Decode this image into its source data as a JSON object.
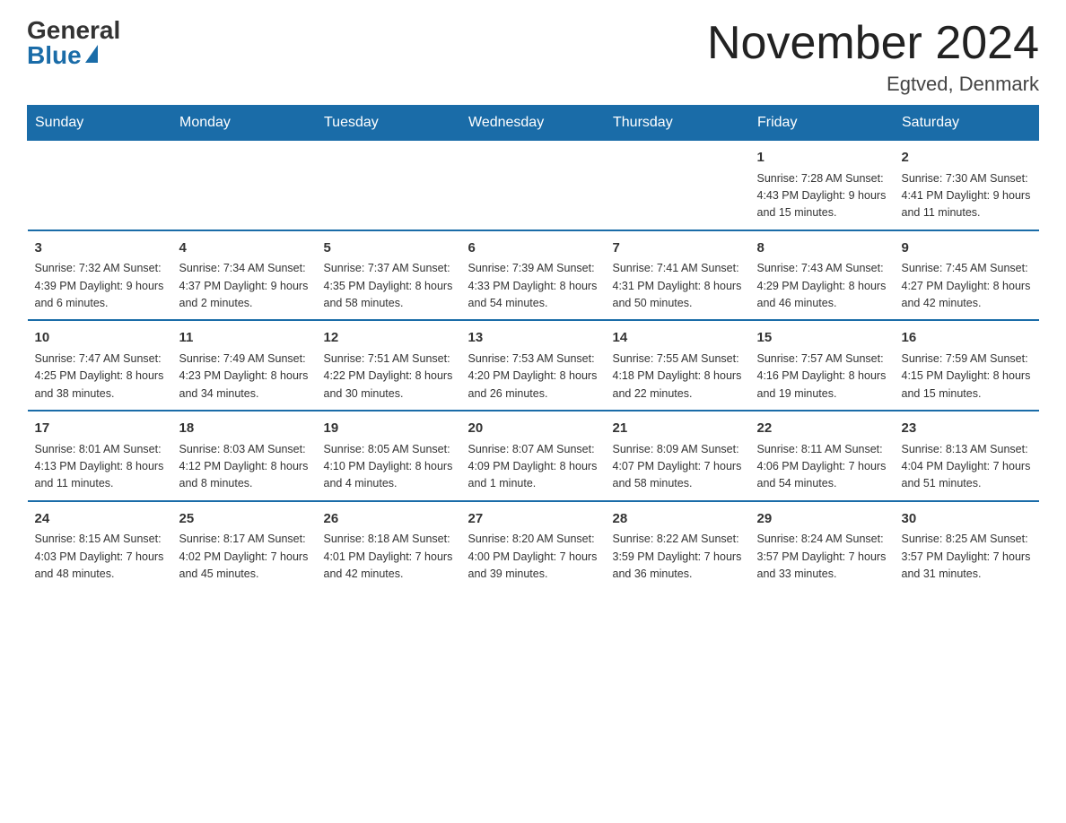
{
  "header": {
    "logo_general": "General",
    "logo_blue": "Blue",
    "month_title": "November 2024",
    "location": "Egtved, Denmark"
  },
  "days_of_week": [
    "Sunday",
    "Monday",
    "Tuesday",
    "Wednesday",
    "Thursday",
    "Friday",
    "Saturday"
  ],
  "weeks": [
    [
      {
        "day": "",
        "info": ""
      },
      {
        "day": "",
        "info": ""
      },
      {
        "day": "",
        "info": ""
      },
      {
        "day": "",
        "info": ""
      },
      {
        "day": "",
        "info": ""
      },
      {
        "day": "1",
        "info": "Sunrise: 7:28 AM\nSunset: 4:43 PM\nDaylight: 9 hours and 15 minutes."
      },
      {
        "day": "2",
        "info": "Sunrise: 7:30 AM\nSunset: 4:41 PM\nDaylight: 9 hours and 11 minutes."
      }
    ],
    [
      {
        "day": "3",
        "info": "Sunrise: 7:32 AM\nSunset: 4:39 PM\nDaylight: 9 hours and 6 minutes."
      },
      {
        "day": "4",
        "info": "Sunrise: 7:34 AM\nSunset: 4:37 PM\nDaylight: 9 hours and 2 minutes."
      },
      {
        "day": "5",
        "info": "Sunrise: 7:37 AM\nSunset: 4:35 PM\nDaylight: 8 hours and 58 minutes."
      },
      {
        "day": "6",
        "info": "Sunrise: 7:39 AM\nSunset: 4:33 PM\nDaylight: 8 hours and 54 minutes."
      },
      {
        "day": "7",
        "info": "Sunrise: 7:41 AM\nSunset: 4:31 PM\nDaylight: 8 hours and 50 minutes."
      },
      {
        "day": "8",
        "info": "Sunrise: 7:43 AM\nSunset: 4:29 PM\nDaylight: 8 hours and 46 minutes."
      },
      {
        "day": "9",
        "info": "Sunrise: 7:45 AM\nSunset: 4:27 PM\nDaylight: 8 hours and 42 minutes."
      }
    ],
    [
      {
        "day": "10",
        "info": "Sunrise: 7:47 AM\nSunset: 4:25 PM\nDaylight: 8 hours and 38 minutes."
      },
      {
        "day": "11",
        "info": "Sunrise: 7:49 AM\nSunset: 4:23 PM\nDaylight: 8 hours and 34 minutes."
      },
      {
        "day": "12",
        "info": "Sunrise: 7:51 AM\nSunset: 4:22 PM\nDaylight: 8 hours and 30 minutes."
      },
      {
        "day": "13",
        "info": "Sunrise: 7:53 AM\nSunset: 4:20 PM\nDaylight: 8 hours and 26 minutes."
      },
      {
        "day": "14",
        "info": "Sunrise: 7:55 AM\nSunset: 4:18 PM\nDaylight: 8 hours and 22 minutes."
      },
      {
        "day": "15",
        "info": "Sunrise: 7:57 AM\nSunset: 4:16 PM\nDaylight: 8 hours and 19 minutes."
      },
      {
        "day": "16",
        "info": "Sunrise: 7:59 AM\nSunset: 4:15 PM\nDaylight: 8 hours and 15 minutes."
      }
    ],
    [
      {
        "day": "17",
        "info": "Sunrise: 8:01 AM\nSunset: 4:13 PM\nDaylight: 8 hours and 11 minutes."
      },
      {
        "day": "18",
        "info": "Sunrise: 8:03 AM\nSunset: 4:12 PM\nDaylight: 8 hours and 8 minutes."
      },
      {
        "day": "19",
        "info": "Sunrise: 8:05 AM\nSunset: 4:10 PM\nDaylight: 8 hours and 4 minutes."
      },
      {
        "day": "20",
        "info": "Sunrise: 8:07 AM\nSunset: 4:09 PM\nDaylight: 8 hours and 1 minute."
      },
      {
        "day": "21",
        "info": "Sunrise: 8:09 AM\nSunset: 4:07 PM\nDaylight: 7 hours and 58 minutes."
      },
      {
        "day": "22",
        "info": "Sunrise: 8:11 AM\nSunset: 4:06 PM\nDaylight: 7 hours and 54 minutes."
      },
      {
        "day": "23",
        "info": "Sunrise: 8:13 AM\nSunset: 4:04 PM\nDaylight: 7 hours and 51 minutes."
      }
    ],
    [
      {
        "day": "24",
        "info": "Sunrise: 8:15 AM\nSunset: 4:03 PM\nDaylight: 7 hours and 48 minutes."
      },
      {
        "day": "25",
        "info": "Sunrise: 8:17 AM\nSunset: 4:02 PM\nDaylight: 7 hours and 45 minutes."
      },
      {
        "day": "26",
        "info": "Sunrise: 8:18 AM\nSunset: 4:01 PM\nDaylight: 7 hours and 42 minutes."
      },
      {
        "day": "27",
        "info": "Sunrise: 8:20 AM\nSunset: 4:00 PM\nDaylight: 7 hours and 39 minutes."
      },
      {
        "day": "28",
        "info": "Sunrise: 8:22 AM\nSunset: 3:59 PM\nDaylight: 7 hours and 36 minutes."
      },
      {
        "day": "29",
        "info": "Sunrise: 8:24 AM\nSunset: 3:57 PM\nDaylight: 7 hours and 33 minutes."
      },
      {
        "day": "30",
        "info": "Sunrise: 8:25 AM\nSunset: 3:57 PM\nDaylight: 7 hours and 31 minutes."
      }
    ]
  ]
}
